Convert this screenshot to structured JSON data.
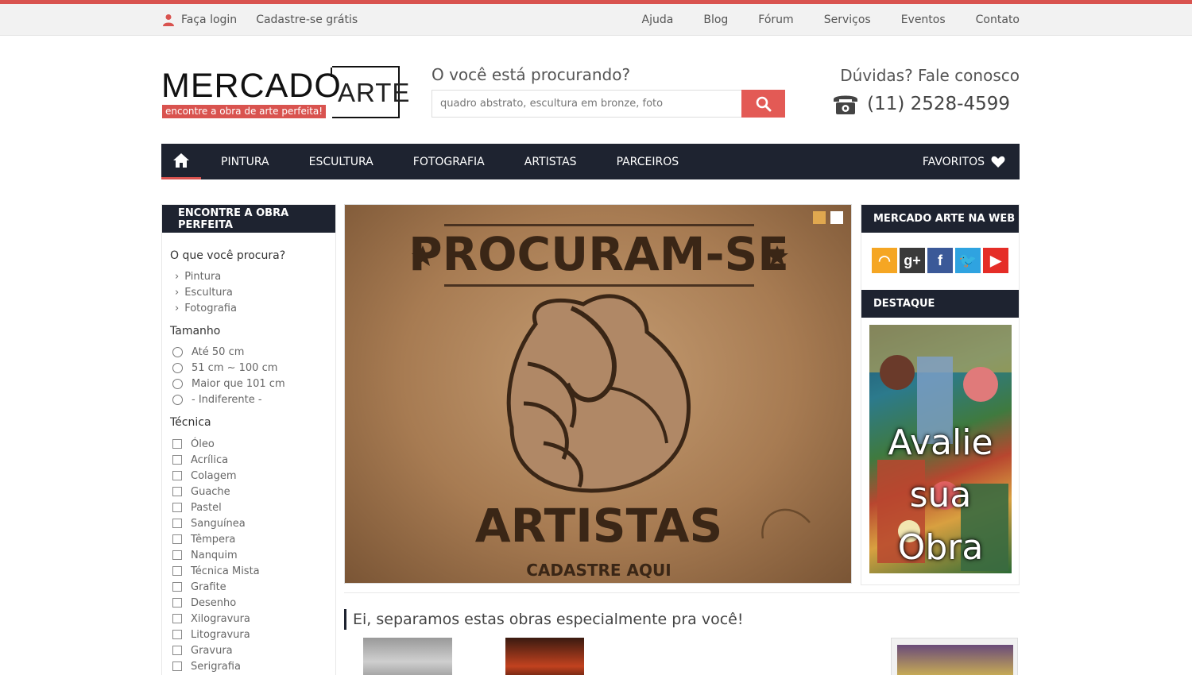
{
  "topbar": {
    "login": "Faça login",
    "signup": "Cadastre-se grátis",
    "links": [
      "Ajuda",
      "Blog",
      "Fórum",
      "Serviços",
      "Eventos",
      "Contato"
    ]
  },
  "logo": {
    "word": "MERCADO",
    "box_word": "ARTE",
    "tagline": "encontre a obra de arte perfeita!"
  },
  "search": {
    "title": "O você está procurando?",
    "placeholder": "quadro abstrato, escultura em bronze, foto"
  },
  "contact": {
    "title": "Dúvidas? Fale conosco",
    "phone": "(11) 2528-4599"
  },
  "nav": {
    "items": [
      "PINTURA",
      "ESCULTURA",
      "FOTOGRAFIA",
      "ARTISTAS",
      "PARCEIROS"
    ],
    "favorites": "FAVORITOS"
  },
  "sidebar": {
    "title": "ENCONTRE A OBRA PERFEITA",
    "what_title": "O que você procura?",
    "what_items": [
      "Pintura",
      "Escultura",
      "Fotografia"
    ],
    "size_title": "Tamanho",
    "size_options": [
      "Até 50 cm",
      "51 cm ~ 100 cm",
      "Maior que 101 cm",
      "- Indiferente -"
    ],
    "technique_title": "Técnica",
    "techniques": [
      "Óleo",
      "Acrílica",
      "Colagem",
      "Guache",
      "Pastel",
      "Sanguínea",
      "Têmpera",
      "Nanquim",
      "Técnica Mista",
      "Grafite",
      "Desenho",
      "Xilogravura",
      "Litogravura",
      "Gravura",
      "Serigrafia"
    ]
  },
  "banner": {
    "headline": "PROCURAM-SE",
    "footline": "ARTISTAS",
    "cta": "CADASTRE AQUI",
    "dot_colors": [
      "#e0a84f",
      "#ffffff"
    ]
  },
  "right": {
    "web_title": "MERCADO ARTE NA WEB",
    "social": [
      {
        "icon": "rss-icon",
        "color": "#f5a623",
        "glyph": "◠"
      },
      {
        "icon": "google-plus-icon",
        "color": "#3a3a3a",
        "glyph": "g+"
      },
      {
        "icon": "facebook-icon",
        "color": "#3b5998",
        "glyph": "f"
      },
      {
        "icon": "twitter-icon",
        "color": "#2fa3e0",
        "glyph": "🐦"
      },
      {
        "icon": "youtube-icon",
        "color": "#e52d27",
        "glyph": "▶"
      }
    ],
    "destaque_title": "DESTAQUE",
    "destaque_text": "Avalie sua Obra"
  },
  "reco": {
    "title": "Ei, separamos estas obras especialmente pra você!"
  }
}
